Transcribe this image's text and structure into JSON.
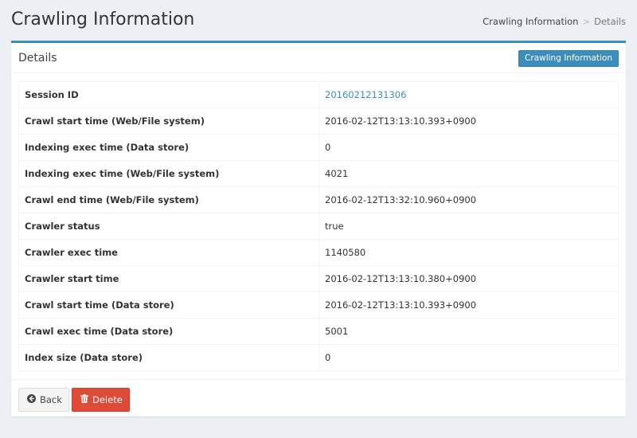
{
  "page": {
    "title": "Crawling Information",
    "breadcrumb": {
      "link": "Crawling Information",
      "separator": ">",
      "active": "Details"
    }
  },
  "box": {
    "title": "Details",
    "header_button": "Crawling Information",
    "rows": [
      {
        "label": "Session ID",
        "value": "20160212131306",
        "is_link": true
      },
      {
        "label": "Crawl start time (Web/File system)",
        "value": "2016-02-12T13:13:10.393+0900"
      },
      {
        "label": "Indexing exec time (Data store)",
        "value": "0"
      },
      {
        "label": "Indexing exec time (Web/File system)",
        "value": "4021"
      },
      {
        "label": "Crawl end time (Web/File system)",
        "value": "2016-02-12T13:32:10.960+0900"
      },
      {
        "label": "Crawler status",
        "value": "true"
      },
      {
        "label": "Crawler exec time",
        "value": "1140580"
      },
      {
        "label": "Crawler start time",
        "value": "2016-02-12T13:13:10.380+0900"
      },
      {
        "label": "Crawl start time (Data store)",
        "value": "2016-02-12T13:13:10.393+0900"
      },
      {
        "label": "Crawl exec time (Data store)",
        "value": "5001"
      },
      {
        "label": "Index size (Data store)",
        "value": "0"
      }
    ],
    "footer": {
      "back_label": "Back",
      "back_icon": "arrow-circle-left-icon",
      "delete_label": "Delete",
      "delete_icon": "trash-icon"
    }
  },
  "colors": {
    "primary": "#3c8dbc",
    "danger": "#dd4b39",
    "background": "#ecf0f5"
  }
}
